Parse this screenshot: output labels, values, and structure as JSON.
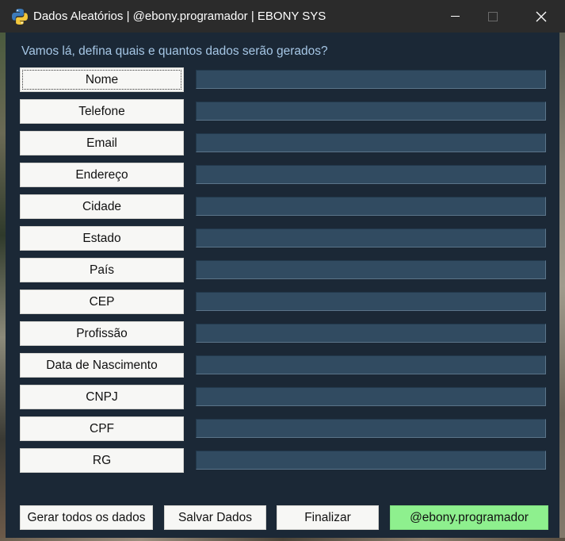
{
  "window": {
    "title": "Dados Aleatórios | @ebony.programador | EBONY SYS",
    "icon": "python-icon"
  },
  "prompt": "Vamos lá, defina quais e quantos dados serão gerados?",
  "fields": [
    {
      "label": "Nome",
      "value": ""
    },
    {
      "label": "Telefone",
      "value": ""
    },
    {
      "label": "Email",
      "value": ""
    },
    {
      "label": "Endereço",
      "value": ""
    },
    {
      "label": "Cidade",
      "value": ""
    },
    {
      "label": "Estado",
      "value": ""
    },
    {
      "label": "País",
      "value": ""
    },
    {
      "label": "CEP",
      "value": ""
    },
    {
      "label": "Profissão",
      "value": ""
    },
    {
      "label": "Data de Nascimento",
      "value": ""
    },
    {
      "label": "CNPJ",
      "value": ""
    },
    {
      "label": "CPF",
      "value": ""
    },
    {
      "label": "RG",
      "value": ""
    }
  ],
  "actions": {
    "generate_all": "Gerar todos os dados",
    "save": "Salvar Dados",
    "finish": "Finalizar",
    "handle": "@ebony.programador"
  },
  "colors": {
    "background": "#1b2836",
    "input": "#314b61",
    "prompt_text": "#a6c7e6",
    "accent_button": "#8ef08e"
  }
}
